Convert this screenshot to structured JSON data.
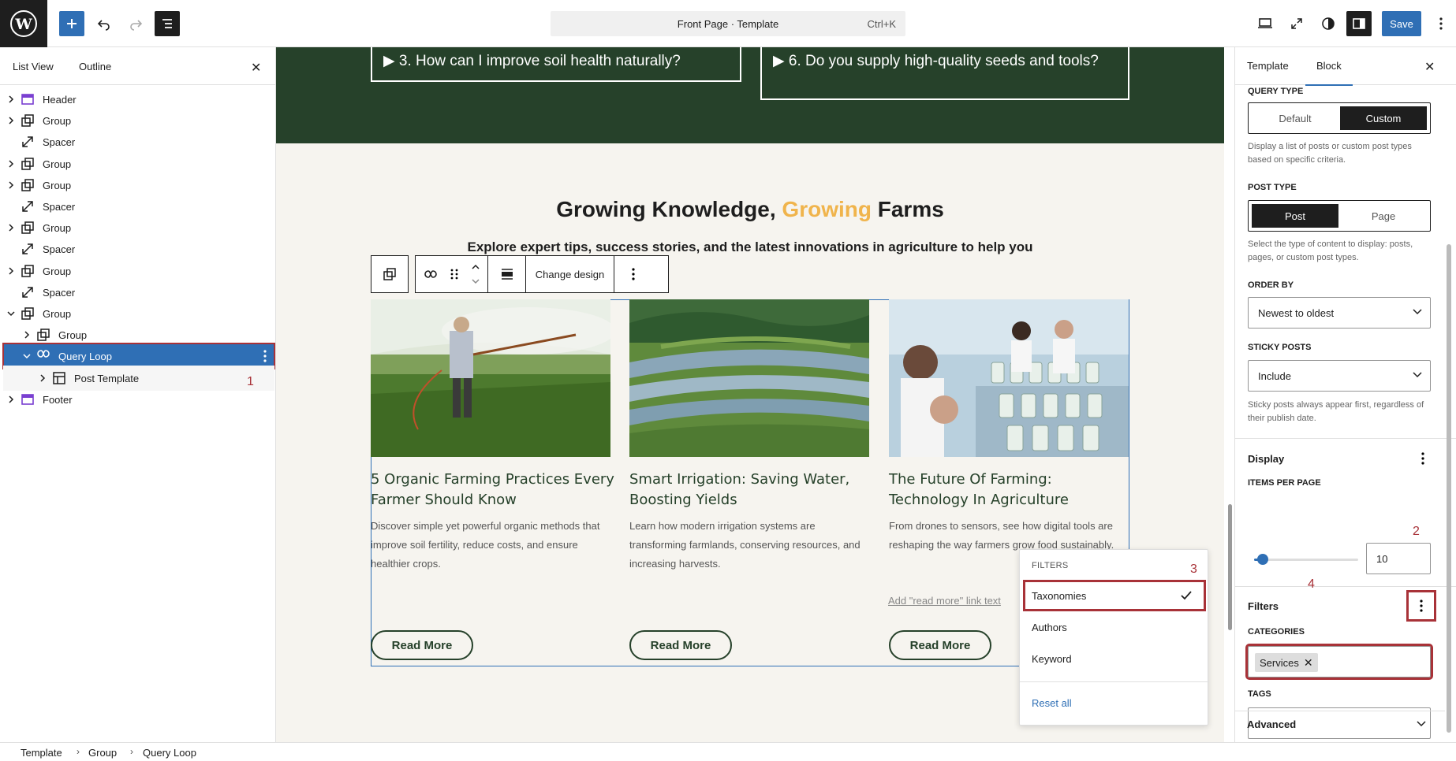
{
  "topbar": {
    "command_title": "Front Page · Template",
    "command_shortcut": "Ctrl+K",
    "save_label": "Save"
  },
  "left_sidebar": {
    "tabs": [
      "List View",
      "Outline"
    ],
    "tree": [
      {
        "label": "Header",
        "icon": "template-part-icon",
        "expandable": true
      },
      {
        "label": "Group",
        "icon": "group-icon",
        "expandable": true
      },
      {
        "label": "Spacer",
        "icon": "spacer-icon",
        "expandable": false
      },
      {
        "label": "Group",
        "icon": "group-icon",
        "expandable": true
      },
      {
        "label": "Group",
        "icon": "group-icon",
        "expandable": true
      },
      {
        "label": "Spacer",
        "icon": "spacer-icon",
        "expandable": false
      },
      {
        "label": "Group",
        "icon": "group-icon",
        "expandable": true
      },
      {
        "label": "Spacer",
        "icon": "spacer-icon",
        "expandable": false
      },
      {
        "label": "Group",
        "icon": "group-icon",
        "expandable": true
      },
      {
        "label": "Spacer",
        "icon": "spacer-icon",
        "expandable": false
      },
      {
        "label": "Group",
        "icon": "group-icon",
        "expandable": true
      },
      {
        "label": "Group",
        "icon": "group-icon",
        "expandable": true
      },
      {
        "label": "Query Loop",
        "icon": "loop-icon",
        "expandable": true,
        "selected": true
      },
      {
        "label": "Post Template",
        "icon": "layout-icon",
        "expandable": true
      },
      {
        "label": "Footer",
        "icon": "template-part-icon",
        "expandable": true
      }
    ]
  },
  "canvas": {
    "faq": [
      "▶ 3. How can I improve soil health naturally?",
      "▶ 6. Do you supply high-quality seeds and tools?"
    ],
    "section_title_part1": "Growing Knowledge, ",
    "section_title_accent": "Growing",
    "section_title_part2": " Farms",
    "section_subtitle": "Explore expert tips, success stories, and the latest innovations in agriculture to help you",
    "block_toolbar": {
      "change_design": "Change design"
    },
    "posts": [
      {
        "title": "5 Organic Farming Practices Every Farmer Should Know",
        "excerpt": "Discover simple yet powerful organic methods that improve soil fertility, reduce costs, and ensure healthier crops.",
        "button": "Read More"
      },
      {
        "title": "Smart Irrigation: Saving Water, Boosting Yields",
        "excerpt": "Learn how modern irrigation systems are transforming farmlands, conserving resources, and increasing harvests.",
        "button": "Read More"
      },
      {
        "title": "The Future Of Farming: Technology In Agriculture",
        "excerpt": "From drones to sensors, see how digital tools are reshaping the way farmers grow food sustainably.",
        "button": "Read More"
      }
    ],
    "add_read_more": "Add \"read more\" link text"
  },
  "filters_popover": {
    "heading": "FILTERS",
    "items": [
      "Taxonomies",
      "Authors",
      "Keyword"
    ],
    "checked": "Taxonomies",
    "reset": "Reset all"
  },
  "right_sidebar": {
    "tabs": [
      "Template",
      "Block"
    ],
    "active_tab": "Block",
    "query_type_label": "QUERY TYPE",
    "query_type_options": [
      "Default",
      "Custom"
    ],
    "query_type_selected": "Custom",
    "query_type_help": "Display a list of posts or custom post types based on specific criteria.",
    "post_type_label": "POST TYPE",
    "post_type_options": [
      "Post",
      "Page"
    ],
    "post_type_selected": "Post",
    "post_type_help": "Select the type of content to display: posts, pages, or custom post types.",
    "order_by_label": "ORDER BY",
    "order_by_value": "Newest to oldest",
    "sticky_label": "STICKY POSTS",
    "sticky_value": "Include",
    "sticky_help": "Sticky posts always appear first, regardless of their publish date.",
    "display_title": "Display",
    "items_per_page_label": "ITEMS PER PAGE",
    "items_per_page": "10",
    "items_per_page_fraction": 0.08,
    "filters_title": "Filters",
    "categories_label": "CATEGORIES",
    "categories_tokens": [
      "Services"
    ],
    "tags_label": "TAGS",
    "advanced_title": "Advanced"
  },
  "annotations": [
    "1",
    "2",
    "3",
    "4"
  ],
  "breadcrumb": [
    "Template",
    "Group",
    "Query Loop"
  ],
  "colors": {
    "accent": "#2f6fb5",
    "forest": "#26412a",
    "gold": "#f0b44c",
    "annotation": "#a83238"
  }
}
